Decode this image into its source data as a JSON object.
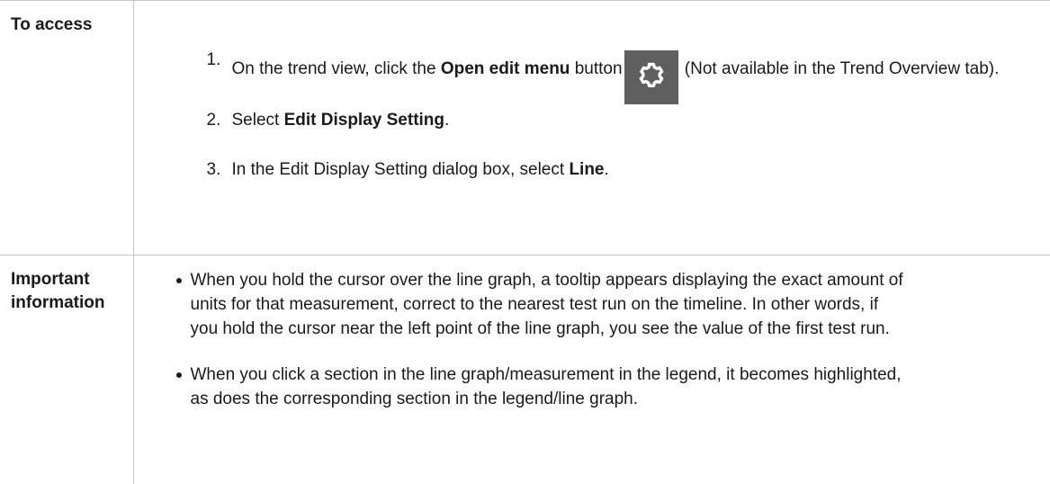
{
  "access": {
    "label": "To access",
    "steps": [
      {
        "num": "1.",
        "before": "On the trend view, click the ",
        "bold": "Open edit menu",
        "middle": " button",
        "after": " (Not available in the Trend Overview tab).",
        "icon": "gear-icon"
      },
      {
        "num": "2.",
        "before": "Select ",
        "bold": "Edit Display Setting",
        "after": "."
      },
      {
        "num": "3.",
        "before": "In the Edit Display Setting dialog box, select ",
        "bold": "Line",
        "after": "."
      }
    ]
  },
  "important": {
    "label": "Important information",
    "bullets": [
      "When you hold the cursor over the line graph, a tooltip appears displaying the exact amount of units for that measurement, correct to the nearest test run on the timeline. In other words, if you hold the cursor near the left point of the line graph, you see the value of the first test run.",
      "When you click a section in the line graph/measurement in the legend, it becomes highlighted, as does the corresponding section in the legend/line graph."
    ]
  },
  "colors": {
    "icon_bg": "#5f5f5f",
    "border": "#c6c6c6"
  }
}
